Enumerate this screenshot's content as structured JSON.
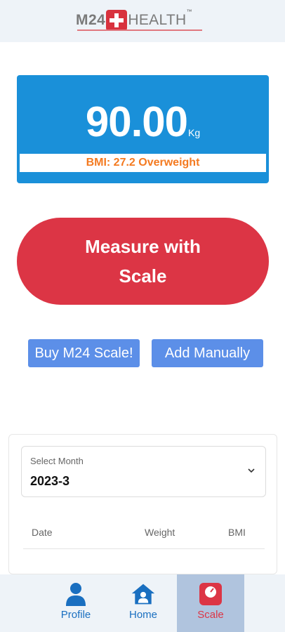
{
  "header": {
    "logo_m24": "M24",
    "logo_health": "HEALTH",
    "logo_tm": "™"
  },
  "weight_card": {
    "value": "90.00",
    "unit": "Kg",
    "bmi_text": "BMI:  27.2 Overweight"
  },
  "actions": {
    "measure_label": "Measure with Scale",
    "buy_label": "Buy M24 Scale!",
    "add_label": "Add Manually"
  },
  "log": {
    "select_label": "Select Month",
    "selected_month": "2023-3",
    "columns": [
      "Date",
      "Weight",
      "BMI"
    ]
  },
  "nav": {
    "items": [
      {
        "label": "Profile",
        "icon": "person-icon"
      },
      {
        "label": "Home",
        "icon": "home-icon"
      },
      {
        "label": "Scale",
        "icon": "scale-icon",
        "active": true
      }
    ]
  },
  "colors": {
    "primary_blue": "#1a90d9",
    "danger_red": "#dc3545",
    "button_blue": "#5c8fe8",
    "bmi_orange": "#f47a20"
  }
}
